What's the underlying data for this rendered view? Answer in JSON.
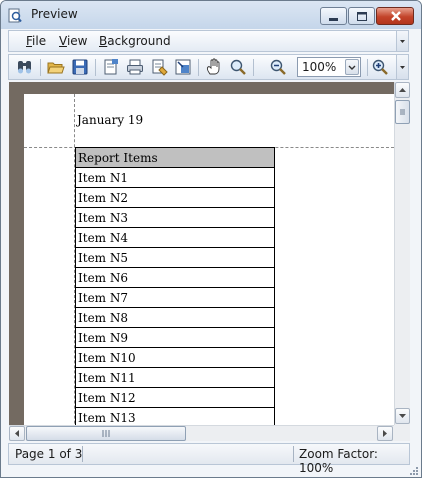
{
  "window": {
    "title": "Preview"
  },
  "menu": [
    {
      "key": "F",
      "rest": "ile"
    },
    {
      "key": "V",
      "rest": "iew"
    },
    {
      "key": "B",
      "rest": "ackground"
    }
  ],
  "toolbar": {
    "zoom_value": "100%",
    "icons": [
      "find-icon",
      "open-icon",
      "save-icon",
      "page-setup-icon",
      "print-icon",
      "print-quick-icon",
      "scale-icon",
      "hand-tool-icon",
      "magnifier-icon",
      "zoom-out-icon",
      "zoom-in-icon"
    ]
  },
  "report": {
    "date": "January 19",
    "header": "Report Items",
    "items": [
      "Item N1",
      "Item N2",
      "Item N3",
      "Item N4",
      "Item N5",
      "Item N6",
      "Item N7",
      "Item N8",
      "Item N9",
      "Item N10",
      "Item N11",
      "Item N12",
      "Item N13"
    ]
  },
  "status": {
    "page_info": "Page 1 of 3",
    "zoom_factor": "Zoom Factor: 100%"
  },
  "colors": {
    "title_bar": "#c5d6ea",
    "close_button": "#c3442a",
    "view_background": "#736a61",
    "table_header": "#c0c0c0"
  }
}
